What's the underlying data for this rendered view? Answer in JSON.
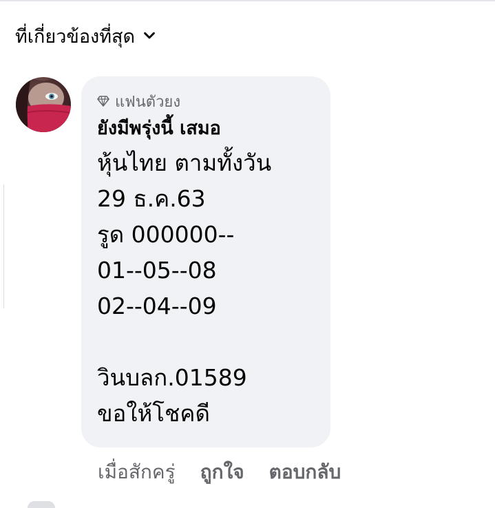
{
  "sort": {
    "label": "ที่เกี่ยวข้องที่สุด",
    "icon": "chevron-down-icon"
  },
  "comment": {
    "avatar_icon": "user-avatar",
    "badge": {
      "icon": "diamond-icon",
      "label": "แฟนตัวยง"
    },
    "author": "ยังมีพรุ่งนี้ เสมอ",
    "lines": [
      "หุ้นไทย ตามทั้งวัน",
      "29 ธ.ค.63",
      "รูด 000000--",
      "01--05--08",
      "02--04--09",
      "",
      "วินบลก.01589",
      "ขอให้โชคดี"
    ],
    "actions": {
      "time": "เมื่อสักครู่",
      "like": "ถูกใจ",
      "reply": "ตอบกลับ"
    }
  },
  "colors": {
    "bubble_bg": "#f0f2f5",
    "secondary_text": "#65676b",
    "primary_text": "#050505"
  }
}
